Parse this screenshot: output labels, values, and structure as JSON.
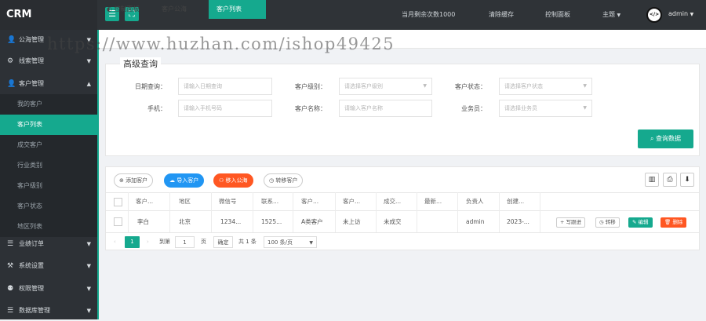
{
  "app": {
    "brand": "CRM"
  },
  "topbar": {
    "menu_icon": "menu-icon",
    "fullscreen_icon": "fullscreen-icon",
    "quota": "当月剩余次数1000",
    "clear_cache": "清除缓存",
    "control_panel": "控制面板",
    "theme": "主题",
    "username": "admin"
  },
  "sidebar": {
    "groups": [
      {
        "label": "公海管理",
        "icon": "user-icon"
      },
      {
        "label": "线索管理",
        "icon": "compass-icon"
      },
      {
        "label": "客户管理",
        "icon": "user-icon"
      },
      {
        "label": "业绩订单",
        "icon": "database-icon"
      },
      {
        "label": "系统设置",
        "icon": "wrench-icon"
      },
      {
        "label": "权限管理",
        "icon": "shield-icon"
      },
      {
        "label": "数据库管理",
        "icon": "database-icon"
      }
    ],
    "customer_items": [
      "我的客户",
      "客户列表",
      "成交客户",
      "行业类别",
      "客户级别",
      "客户状态",
      "地区列表"
    ]
  },
  "tabs": [
    "控制面板",
    "客户公海",
    "客户列表"
  ],
  "watermark": "https://www.huzhan.com/ishop49425",
  "search": {
    "legend": "高级查询",
    "fields": [
      {
        "label": "日期查询：",
        "placeholder": "请输入日期查询"
      },
      {
        "label": "客户级别：",
        "placeholder": "请选择客户级别"
      },
      {
        "label": "客户状态：",
        "placeholder": "请选择客户状态"
      },
      {
        "label": "手机：",
        "placeholder": "请输入手机号码"
      },
      {
        "label": "客户名称：",
        "placeholder": "请输入客户名称"
      },
      {
        "label": "业务员：",
        "placeholder": "请选择业务员"
      }
    ],
    "submit": "查询数据"
  },
  "toolbar": {
    "add": "添加客户",
    "import": "导入客户",
    "move_pool": "移入公海",
    "transfer": "转移客户",
    "colors": {
      "primary": "#15a98e",
      "import": "#2196f3",
      "pool": "#ff5722"
    }
  },
  "table": {
    "headers": [
      "客户...",
      "地区",
      "微信号",
      "联系...",
      "客户...",
      "客户...",
      "成交...",
      "最新...",
      "负责人",
      "创建..."
    ],
    "rows": [
      {
        "cells": [
          "李白",
          "北京",
          "1234...",
          "1525...",
          "A类客户",
          "未上访",
          "未成交",
          "",
          "admin",
          "2023-..."
        ],
        "actions": {
          "follow": "写跟进",
          "transfer": "转移",
          "edit": "编辑",
          "delete": "删除"
        }
      }
    ]
  },
  "pagination": {
    "current_page": "1",
    "goto_label": "到第",
    "goto_value": "1",
    "page_unit": "页",
    "confirm": "确定",
    "total": "共 1 条",
    "page_size": "100 条/页"
  }
}
